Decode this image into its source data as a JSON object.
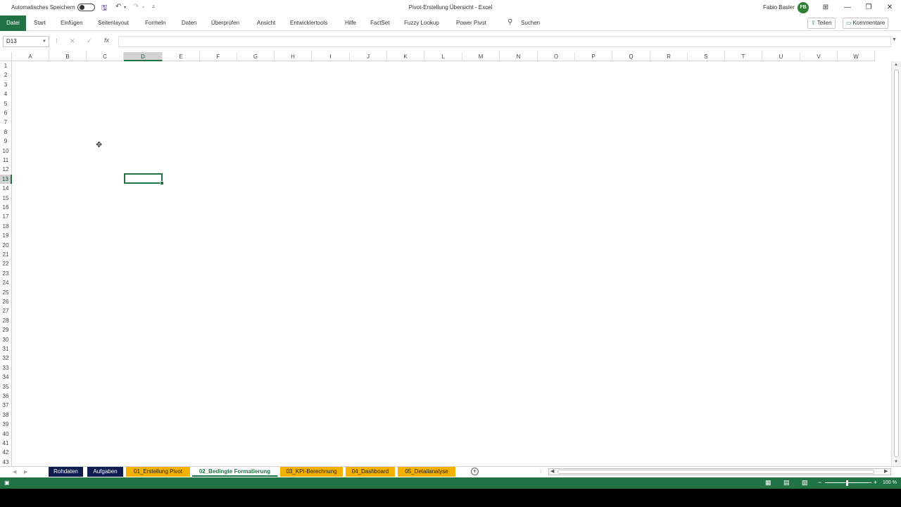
{
  "titlebar": {
    "autosave_label": "Automatisches Speichern",
    "document_title": "Pivot-Erstellung Übersicht  -  Excel",
    "user_name": "Fabio Basler",
    "user_initials": "FB"
  },
  "ribbon": {
    "file_tab": "Datei",
    "tabs": [
      "Start",
      "Einfügen",
      "Seitenlayout",
      "Formeln",
      "Daten",
      "Überprüfen",
      "Ansicht",
      "Entwicklertools",
      "Hilfe",
      "FactSet",
      "Fuzzy Lookup",
      "Power Pivot"
    ],
    "search_label": "Suchen",
    "share_label": "Teilen",
    "comments_label": "Kommentare"
  },
  "formula_bar": {
    "name_box": "D13",
    "fx_label": "fx",
    "formula": ""
  },
  "grid": {
    "columns": [
      "A",
      "B",
      "C",
      "D",
      "E",
      "F",
      "G",
      "H",
      "I",
      "J",
      "K",
      "L",
      "M",
      "N",
      "O",
      "P",
      "Q",
      "R",
      "S",
      "T",
      "U",
      "V",
      "W"
    ],
    "rows": [
      "1",
      "2",
      "3",
      "4",
      "5",
      "6",
      "7",
      "8",
      "9",
      "10",
      "11",
      "12",
      "13",
      "14",
      "15",
      "16",
      "17",
      "18",
      "19",
      "20",
      "21",
      "22",
      "23",
      "24",
      "25",
      "26",
      "27",
      "28",
      "29",
      "30",
      "31",
      "32",
      "33",
      "34",
      "35",
      "36",
      "37",
      "38",
      "39",
      "40",
      "41",
      "42",
      "43"
    ],
    "active_column": "D",
    "active_row": "13"
  },
  "sheets": [
    {
      "label": "Rohdaten",
      "style": "navy"
    },
    {
      "label": "Aufgaben",
      "style": "navy"
    },
    {
      "label": "01_Erstellung Pivot",
      "style": "gold"
    },
    {
      "label": "02_Bedingte Formatierung",
      "style": "active"
    },
    {
      "label": "03_KPI-Berechnung",
      "style": "gold"
    },
    {
      "label": "04_Dashboard",
      "style": "gold"
    },
    {
      "label": "05_Detailanalyse",
      "style": "gold"
    }
  ],
  "statusbar": {
    "zoom_level": "100 %"
  },
  "colors": {
    "accent": "#217346",
    "navy_tab": "#0c1c4e",
    "gold_tab": "#f5b100"
  }
}
